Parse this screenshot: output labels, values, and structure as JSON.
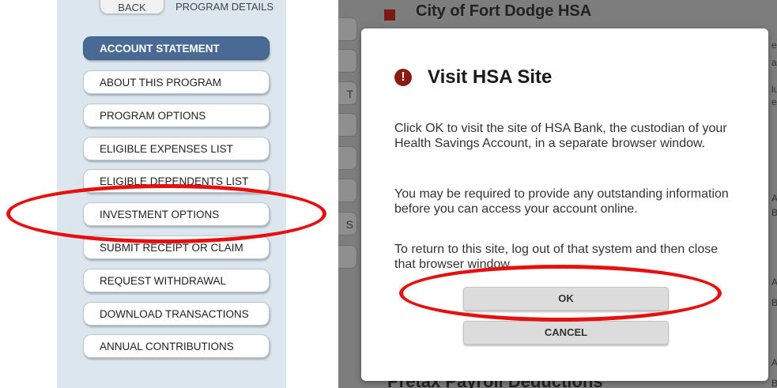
{
  "left_panel": {
    "top_tabs": {
      "back": "BACK",
      "program_details": "PROGRAM DETAILS"
    },
    "menu": [
      {
        "label": "ACCOUNT STATEMENT",
        "active": true
      },
      {
        "label": "ABOUT THIS PROGRAM",
        "active": false
      },
      {
        "label": "PROGRAM OPTIONS",
        "active": false
      },
      {
        "label": "ELIGIBLE EXPENSES LIST",
        "active": false
      },
      {
        "label": "ELIGIBLE DEPENDENTS LIST",
        "active": false
      },
      {
        "label": "INVESTMENT OPTIONS",
        "active": false
      },
      {
        "label": "SUBMIT RECEIPT OR CLAIM",
        "active": false
      },
      {
        "label": "REQUEST WITHDRAWAL",
        "active": false
      },
      {
        "label": "DOWNLOAD TRANSACTIONS",
        "active": false
      },
      {
        "label": "ANNUAL CONTRIBUTIONS",
        "active": false
      }
    ]
  },
  "background_page": {
    "title": "City of Fort Dodge HSA",
    "bottom_title": "Pretax Payroll Deductions",
    "side_button_fragments": [
      "T",
      "S"
    ],
    "right_fragments": [
      "ec",
      "ar",
      "lu",
      "e",
      "Ac",
      "Ba",
      "Ac",
      "Ba",
      "Ac",
      "Ba"
    ]
  },
  "modal": {
    "title": "Visit HSA Site",
    "icon": "exclamation-circle-icon",
    "paragraph1": "Click OK to visit the site of HSA Bank, the custodian of your Health Savings Account, in a separate browser window.",
    "paragraph2": "You may be required to provide any outstanding information before you can access your account online.",
    "paragraph3": "To return to this site, log out of that system and then close that browser window.",
    "ok_label": "OK",
    "cancel_label": "CANCEL"
  },
  "colors": {
    "active_menu": "#4a6a96",
    "panel_bg": "#dbe6ef",
    "alert_icon": "#8b1a10",
    "annotation": "#e8100f"
  }
}
